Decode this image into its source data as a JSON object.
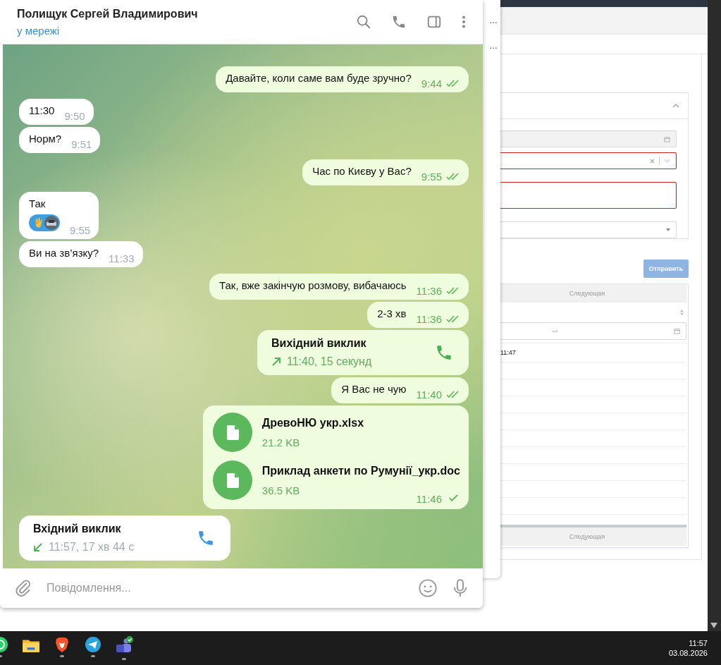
{
  "browser": {
    "submit_button": "Отправить",
    "pager_top": "Следующая",
    "first_cell": "11:47",
    "pager_bottom": "Следующая"
  },
  "popup_behind": {
    "lines": [
      "…",
      "…"
    ]
  },
  "chat": {
    "header": {
      "name": "Полищук Сергей Владимирович",
      "status": "у мережі"
    },
    "messages": [
      {
        "outgoing": true,
        "kind": "text",
        "text": "Давайте, коли саме вам буде зручно?",
        "time": "9:44",
        "read": true
      },
      {
        "outgoing": false,
        "kind": "text",
        "text": "11:30",
        "time": "9:50"
      },
      {
        "outgoing": false,
        "kind": "text",
        "text": "Норм?",
        "time": "9:51"
      },
      {
        "outgoing": true,
        "kind": "text",
        "text": "Час по Києву у Вас?",
        "time": "9:55",
        "read": true
      },
      {
        "outgoing": false,
        "kind": "text",
        "text": "Так",
        "time": "9:55",
        "reaction": true
      },
      {
        "outgoing": false,
        "kind": "text",
        "text": "Ви на зв’язку?",
        "time": "11:33"
      },
      {
        "outgoing": true,
        "kind": "text",
        "text": "Так, вже закінчую розмову, вибачаюсь",
        "time": "11:36",
        "read": true
      },
      {
        "outgoing": true,
        "kind": "text",
        "text": "2-3 хв",
        "time": "11:36",
        "read": true
      },
      {
        "outgoing": true,
        "kind": "call",
        "title": "Вихідний виклик",
        "detail": "11:40, 15 секунд"
      },
      {
        "outgoing": true,
        "kind": "text",
        "text": "Я Вас не чую",
        "time": "11:40",
        "read": true
      },
      {
        "outgoing": true,
        "kind": "files",
        "files": [
          {
            "name": "ДревоНЮ укр.xlsx",
            "size": "21.2 KB"
          },
          {
            "name": "Приклад анкети по Румунії_укр.doc",
            "size": "36.5 KB"
          }
        ],
        "time": "11:46",
        "read": false
      },
      {
        "outgoing": false,
        "kind": "call",
        "title": "Вхідний виклик",
        "detail": "11:57, 17 хв 44 с"
      }
    ],
    "composer": {
      "placeholder": "Повідомлення..."
    }
  },
  "taskbar": {
    "apps": [
      {
        "kind": "whatsapp",
        "running": true
      },
      {
        "kind": "folder",
        "running": false
      },
      {
        "kind": "brave",
        "running": true
      },
      {
        "kind": "telegram",
        "running": true
      },
      {
        "kind": "teams",
        "running": true
      }
    ],
    "time": "11:57",
    "date": "03.08.2026"
  }
}
